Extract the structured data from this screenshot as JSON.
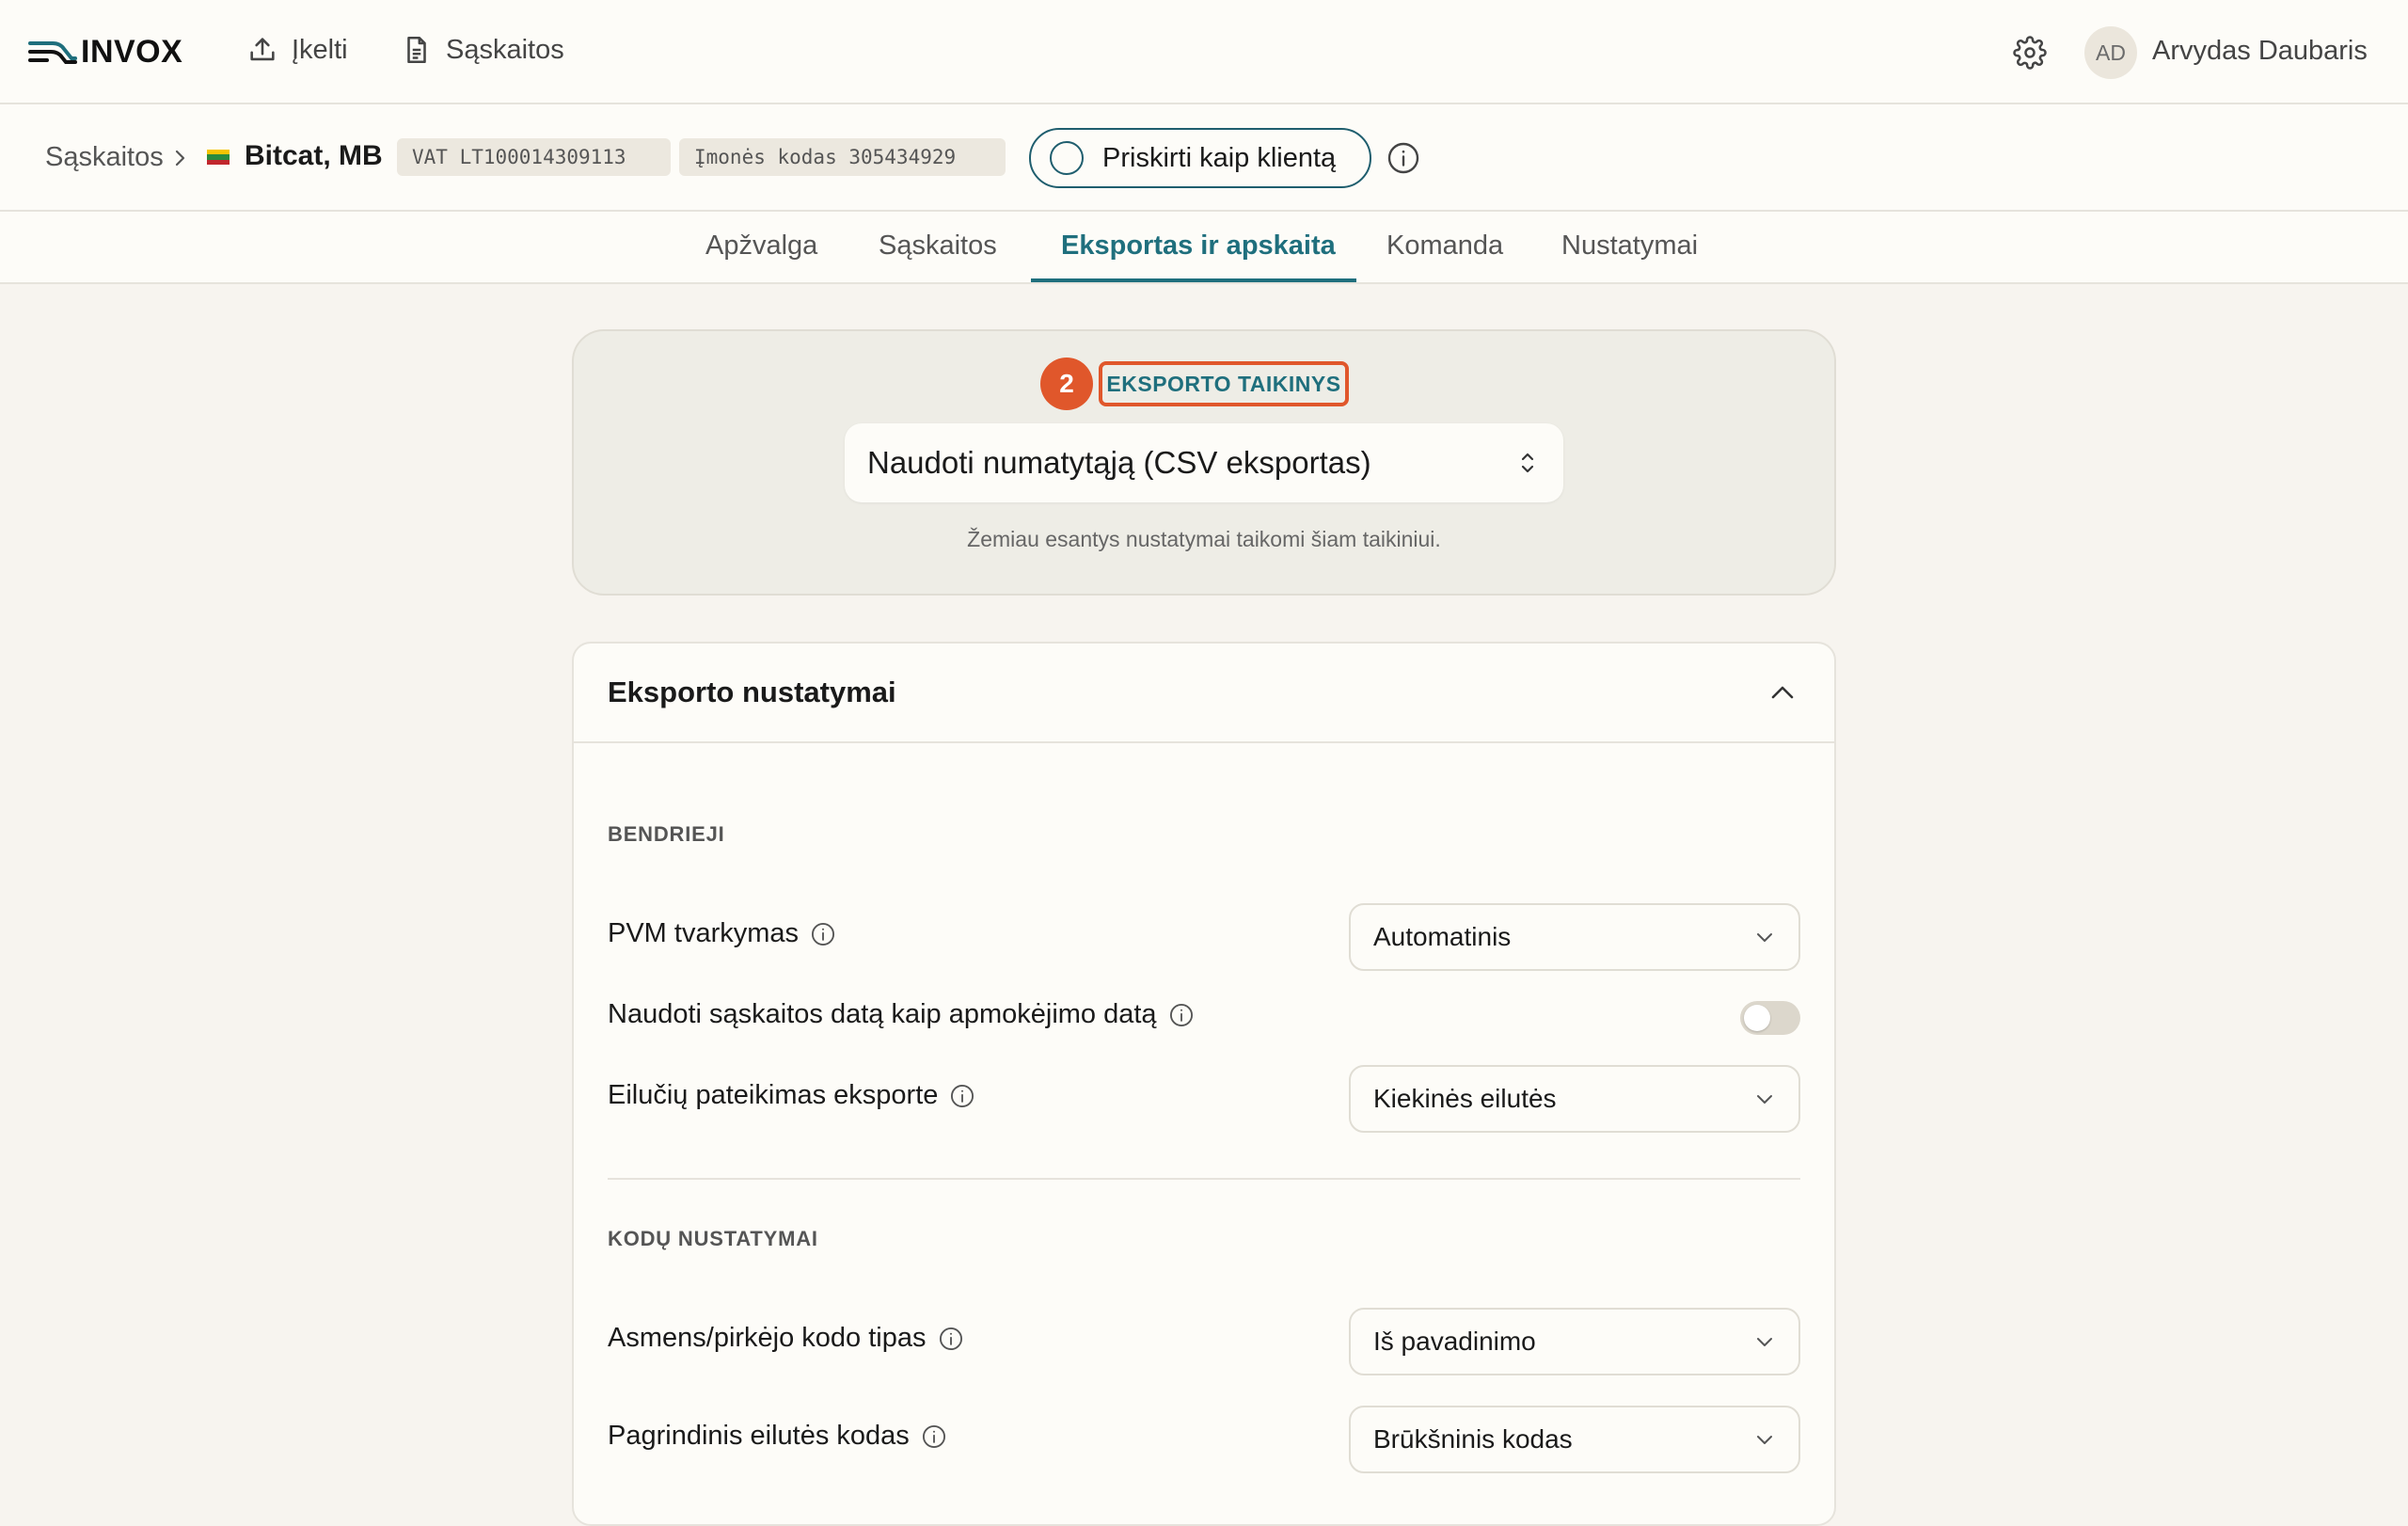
{
  "app": {
    "logo_text": "INVOX"
  },
  "topnav": {
    "upload_label": "Įkelti",
    "invoices_label": "Sąskaitos"
  },
  "user": {
    "initials": "AD",
    "name": "Arvydas Daubaris"
  },
  "breadcrumb": {
    "root": "Sąskaitos",
    "company": "Bitcat, MB",
    "vat_tag": "VAT LT100014309113",
    "code_tag": "Įmonės kodas 305434929",
    "assign_label": "Priskirti kaip klientą"
  },
  "tabs": [
    {
      "label": "Apžvalga",
      "active": false
    },
    {
      "label": "Sąskaitos",
      "active": false
    },
    {
      "label": "Eksportas ir apskaita",
      "active": true
    },
    {
      "label": "Komanda",
      "active": false
    },
    {
      "label": "Nustatymai",
      "active": false
    }
  ],
  "export_target": {
    "step_number": "2",
    "label": "EKSPORTO TAIKINYS",
    "selected": "Naudoti numatytąją (CSV eksportas)",
    "help": "Žemiau esantys nustatymai taikomi šiam taikiniui."
  },
  "export_settings": {
    "title": "Eksporto nustatymai",
    "general": {
      "section_label": "BENDRIEJI",
      "vat_handling": {
        "label": "PVM tvarkymas",
        "value": "Automatinis"
      },
      "use_invoice_date": {
        "label": "Naudoti sąskaitos datą kaip apmokėjimo datą",
        "enabled": false
      },
      "line_presentation": {
        "label": "Eilučių pateikimas eksporte",
        "value": "Kiekinės eilutės"
      }
    },
    "codes": {
      "section_label": "KODŲ NUSTATYMAI",
      "buyer_code_type": {
        "label": "Asmens/pirkėjo kodo tipas",
        "value": "Iš pavadinimo"
      },
      "main_line_code": {
        "label": "Pagrindinis eilutės kodas",
        "value": "Brūkšninis kodas"
      }
    }
  },
  "colors": {
    "accent": "#1f6f7d",
    "highlight": "#e0572b",
    "background": "#f7f4ef"
  },
  "flag_colors": [
    "#f5c400",
    "#2a8a3e",
    "#c1272d"
  ]
}
